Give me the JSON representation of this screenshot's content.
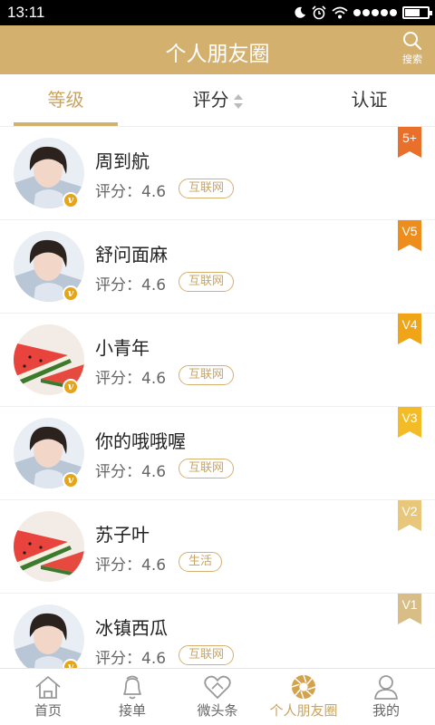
{
  "status_bar": {
    "time": "13:11"
  },
  "header": {
    "title": "个人朋友圈",
    "search_label": "搜索"
  },
  "tabs": [
    {
      "label": "等级"
    },
    {
      "label": "评分"
    },
    {
      "label": "认证"
    }
  ],
  "friends": [
    {
      "name": "周到航",
      "rating": "评分：4.6",
      "tag": "互联网",
      "level": "5+",
      "level_color": "#e8702a",
      "avatar": "girl"
    },
    {
      "name": "舒问面麻",
      "rating": "评分：4.6",
      "tag": "互联网",
      "level": "V5",
      "level_color": "#ee8d1c",
      "avatar": "girl"
    },
    {
      "name": "小青年",
      "rating": "评分：4.6",
      "tag": "互联网",
      "level": "V4",
      "level_color": "#f0a418",
      "avatar": "watermelon"
    },
    {
      "name": "你的哦哦喔",
      "rating": "评分：4.6",
      "tag": "互联网",
      "level": "V3",
      "level_color": "#f3bc26",
      "avatar": "girl"
    },
    {
      "name": "苏子叶",
      "rating": "评分：4.6",
      "tag": "生活",
      "level": "V2",
      "level_color": "#e9c77a",
      "avatar": "watermelon"
    },
    {
      "name": "冰镇西瓜",
      "rating": "评分：4.6",
      "tag": "互联网",
      "level": "V1",
      "level_color": "#d8bd86",
      "avatar": "girl"
    }
  ],
  "bottom_nav": [
    {
      "label": "首页",
      "icon": "home-icon"
    },
    {
      "label": "接单",
      "icon": "bell-icon"
    },
    {
      "label": "微头条",
      "icon": "heart-hands-icon"
    },
    {
      "label": "个人朋友圈",
      "icon": "aperture-icon"
    },
    {
      "label": "我的",
      "icon": "user-icon"
    }
  ],
  "colors": {
    "accent": "#d4b06f",
    "accent_text": "#c9a461",
    "status_bar": "#000000",
    "vip_badge": "#e6a519"
  }
}
